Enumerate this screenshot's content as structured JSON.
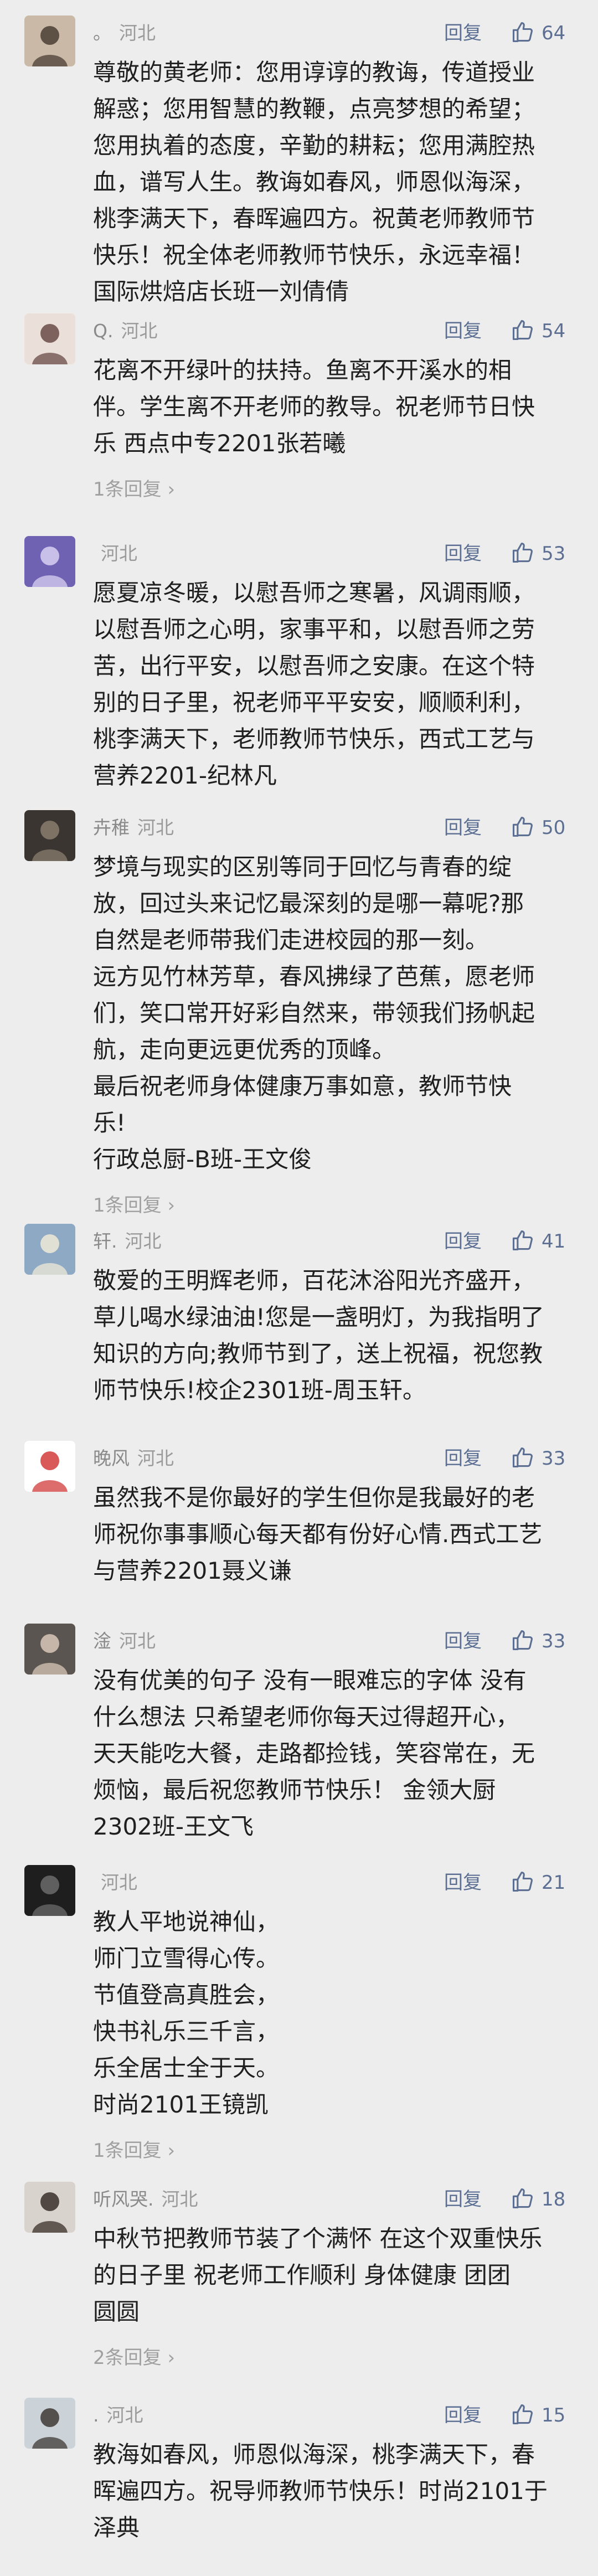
{
  "reply_label": "回复",
  "colors": {
    "background": "#ededed",
    "link": "#5c6f93",
    "text": "#1f1f1f",
    "meta": "#9a9a9a"
  },
  "icons": {
    "like": "thumbs-up-icon",
    "sub_reply_arrow": "chevron-right-icon"
  },
  "comments": [
    {
      "username": "。",
      "location": "河北",
      "likes": "64",
      "lines": [
        "尊敬的黄老师：您用谆谆的教诲，传道授业",
        "解惑；您用智慧的教鞭，点亮梦想的希望；",
        "您用执着的态度，辛勤的耕耘；您用满腔热",
        "血，谱写人生。教诲如春风，师恩似海深，",
        "桃李满天下，春晖遍四方。祝黄老师教师节",
        "快乐！祝全体老师教师节快乐，永远幸福！",
        "国际烘焙店长班一刘倩倩"
      ],
      "sub_reply": ""
    },
    {
      "username": "Q.",
      "location": "河北",
      "likes": "54",
      "lines": [
        "花离不开绿叶的扶持。鱼离不开溪水的相",
        "伴。学生离不开老师的教导。祝老师节日快",
        "乐                    西点中专2201张若曦"
      ],
      "sub_reply": "1条回复 ›"
    },
    {
      "username": "",
      "location": "河北",
      "likes": "53",
      "lines": [
        "愿夏凉冬暖，以慰吾师之寒暑，风调雨顺，",
        "以慰吾师之心明，家事平和，以慰吾师之劳",
        "苦，出行平安，以慰吾师之安康。在这个特",
        "别的日子里，祝老师平平安安，顺顺利利，",
        "桃李满天下，老师教师节快乐，西式工艺与",
        "营养2201-纪林凡"
      ],
      "sub_reply": ""
    },
    {
      "username": "卉稚",
      "location": "河北",
      "likes": "50",
      "lines": [
        "梦境与现实的区别等同于回忆与青春的绽",
        "放，回过头来记忆最深刻的是哪一幕呢?那",
        "自然是老师带我们走进校园的那一刻。",
        "远方见竹林芳草，春风拂绿了芭蕉，愿老师",
        "们，笑口常开好彩自然来，带领我们扬帆起",
        "航，走向更远更优秀的顶峰。",
        "最后祝老师身体健康万事如意，教师节快",
        "乐!",
        "行政总厨-B班-王文俊"
      ],
      "sub_reply": "1条回复 ›"
    },
    {
      "username": "轩.",
      "location": "河北",
      "likes": "41",
      "lines": [
        "敬爱的王明辉老师，百花沐浴阳光齐盛开，",
        "草儿喝水绿油油!您是一盏明灯，为我指明了",
        "知识的方向;教师节到了，送上祝福，祝您教",
        "师节快乐!校企2301班-周玉轩。"
      ],
      "sub_reply": ""
    },
    {
      "username": "晚风",
      "location": "河北",
      "likes": "33",
      "lines": [
        "虽然我不是你最好的学生但你是我最好的老",
        "师祝你事事顺心每天都有份好心情.西式工艺",
        "与营养2201聂义谦"
      ],
      "sub_reply": ""
    },
    {
      "username": "淦",
      "location": "河北",
      "likes": "33",
      "lines": [
        "没有优美的句子  没有一眼难忘的字体  没有",
        "什么想法  只希望老师你每天过得超开心，",
        "天天能吃大餐，走路都捡钱，笑容常在，无",
        "烦恼，最后祝您教师节快乐！ 金领大厨",
        "2302班-王文飞"
      ],
      "sub_reply": ""
    },
    {
      "username": "",
      "location": "河北",
      "likes": "21",
      "lines": [
        "教人平地说神仙，",
        "师门立雪得心传。",
        "节值登高真胜会，",
        "快书礼乐三千言，",
        "乐全居士全于天。",
        "时尚2101王镜凯"
      ],
      "sub_reply": "1条回复 ›"
    },
    {
      "username": "听风哭.",
      "location": "河北",
      "likes": "18",
      "lines": [
        "中秋节把教师节装了个满怀 在这个双重快乐",
        "的日子里  祝老师工作顺利  身体健康  团团",
        "圆圆"
      ],
      "sub_reply": "2条回复 ›"
    },
    {
      "username": ".",
      "location": "河北",
      "likes": "15",
      "lines": [
        "教海如春风，师恩似海深，桃李满天下，春",
        "晖遍四方。祝导师教师节快乐！时尚2101于",
        "泽典"
      ],
      "sub_reply": ""
    }
  ]
}
